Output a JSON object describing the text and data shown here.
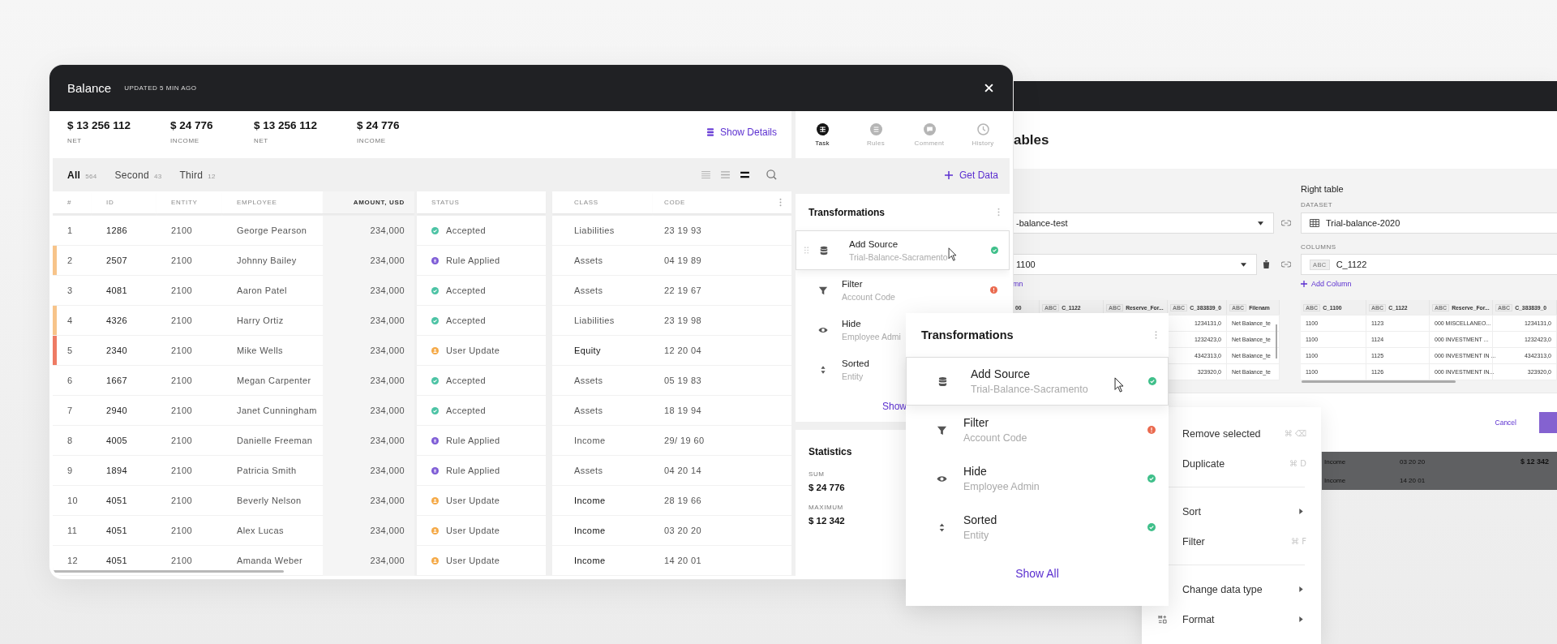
{
  "main_window": {
    "title": "Balance",
    "subtitle": "UPDATED 5 MIN AGO",
    "stats": [
      {
        "value": "$ 13 256 112",
        "label": "NET"
      },
      {
        "value": "$ 24 776",
        "label": "INCOME"
      },
      {
        "value": "$ 13 256 112",
        "label": "NET"
      },
      {
        "value": "$ 24 776",
        "label": "INCOME"
      }
    ],
    "show_details": "Show Details",
    "tabs": [
      {
        "label": "All",
        "count": "564",
        "selected": true
      },
      {
        "label": "Second",
        "count": "43",
        "selected": false
      },
      {
        "label": "Third",
        "count": "12",
        "selected": false
      }
    ],
    "view_options": [
      {
        "kind": "compact",
        "selected": false
      },
      {
        "kind": "normal",
        "selected": false
      },
      {
        "kind": "comfortable",
        "selected": true
      }
    ],
    "table": {
      "columns": [
        "#",
        "ID",
        "ENTITY",
        "EMPLOYEE",
        "AMOUNT, USD",
        "STATUS",
        "CLASS",
        "CODE"
      ],
      "rows": [
        {
          "n": "1",
          "id": "1286",
          "entity": "2100",
          "employee": "George Pearson",
          "amount": "234,000",
          "status": {
            "kind": "accepted",
            "label": "Accepted"
          },
          "class": "Liabilities",
          "class_emphasis": false,
          "code": "23 19 93"
        },
        {
          "n": "2",
          "id": "2507",
          "entity": "2100",
          "employee": "Johnny Bailey",
          "amount": "234,000",
          "status": {
            "kind": "rule",
            "label": "Rule Applied"
          },
          "class": "Assets",
          "class_emphasis": false,
          "code": "04 19 89",
          "color": "#f7c48a"
        },
        {
          "n": "3",
          "id": "4081",
          "entity": "2100",
          "employee": "Aaron Patel",
          "amount": "234,000",
          "status": {
            "kind": "accepted",
            "label": "Accepted"
          },
          "class": "Assets",
          "class_emphasis": false,
          "code": "22 19 67"
        },
        {
          "n": "4",
          "id": "4326",
          "entity": "2100",
          "employee": "Harry Ortiz",
          "amount": "234,000",
          "status": {
            "kind": "accepted",
            "label": "Accepted"
          },
          "class": "Liabilities",
          "class_emphasis": false,
          "code": "23 19 98",
          "color": "#f7c48a"
        },
        {
          "n": "5",
          "id": "2340",
          "entity": "2100",
          "employee": "Mike Wells",
          "amount": "234,000",
          "status": {
            "kind": "user",
            "label": "User Update"
          },
          "class": "Equity",
          "class_emphasis": true,
          "code": "12 20 04",
          "color": "#ee7b64"
        },
        {
          "n": "6",
          "id": "1667",
          "entity": "2100",
          "employee": "Megan Carpenter",
          "amount": "234,000",
          "status": {
            "kind": "accepted",
            "label": "Accepted"
          },
          "class": "Assets",
          "class_emphasis": false,
          "code": "05 19 83"
        },
        {
          "n": "7",
          "id": "2940",
          "entity": "2100",
          "employee": "Janet Cunningham",
          "amount": "234,000",
          "status": {
            "kind": "accepted",
            "label": "Accepted"
          },
          "class": "Assets",
          "class_emphasis": false,
          "code": "18 19 94"
        },
        {
          "n": "8",
          "id": "4005",
          "entity": "2100",
          "employee": "Danielle Freeman",
          "amount": "234,000",
          "status": {
            "kind": "rule",
            "label": "Rule Applied"
          },
          "class": "Income",
          "class_emphasis": false,
          "code": "29/ 19 60"
        },
        {
          "n": "9",
          "id": "1894",
          "entity": "2100",
          "employee": "Patricia Smith",
          "amount": "234,000",
          "status": {
            "kind": "rule",
            "label": "Rule Applied"
          },
          "class": "Assets",
          "class_emphasis": false,
          "code": "04 20 14"
        },
        {
          "n": "10",
          "id": "4051",
          "entity": "2100",
          "employee": "Beverly Nelson",
          "amount": "234,000",
          "status": {
            "kind": "user",
            "label": "User Update"
          },
          "class": "Income",
          "class_emphasis": true,
          "code": "28 19 66"
        },
        {
          "n": "11",
          "id": "4051",
          "entity": "2100",
          "employee": "Alex Lucas",
          "amount": "234,000",
          "status": {
            "kind": "user",
            "label": "User Update"
          },
          "class": "Income",
          "class_emphasis": true,
          "code": "03 20 20"
        },
        {
          "n": "12",
          "id": "4051",
          "entity": "2100",
          "employee": "Amanda Weber",
          "amount": "234,000",
          "status": {
            "kind": "user",
            "label": "User Update"
          },
          "class": "Income",
          "class_emphasis": true,
          "code": "14 20 01"
        }
      ]
    },
    "side_tabs": [
      {
        "kind": "task",
        "label": "Task",
        "selected": true
      },
      {
        "kind": "rules",
        "label": "Rules",
        "selected": false
      },
      {
        "kind": "comment",
        "label": "Comment",
        "selected": false
      },
      {
        "kind": "history",
        "label": "History",
        "selected": false
      }
    ],
    "get_data": "Get Data",
    "transformations": {
      "title": "Transformations",
      "items": [
        {
          "kind": "source",
          "title": "Add Source",
          "subtitle": "Trial-Balance-Sacramento",
          "status": {
            "kind": "ok"
          },
          "selected": true
        },
        {
          "kind": "filter",
          "title": "Filter",
          "subtitle": "Account Code",
          "status": {
            "kind": "error"
          },
          "selected": false
        },
        {
          "kind": "hide",
          "title": "Hide",
          "subtitle": "Employee Admi",
          "selected": false
        },
        {
          "kind": "sort",
          "title": "Sorted",
          "subtitle": "Entity",
          "selected": false
        }
      ],
      "show_all": "Show"
    },
    "statistics": {
      "title": "Statistics",
      "items": [
        {
          "label": "SUM",
          "value": "$ 24 776"
        },
        {
          "label": "MAXIMUM",
          "value": "$ 12 342"
        }
      ]
    }
  },
  "transformations_popup": {
    "title": "Transformations",
    "items": [
      {
        "kind": "source",
        "title": "Add Source",
        "subtitle": "Trial-Balance-Sacramento",
        "status": {
          "kind": "ok"
        },
        "selected": true
      },
      {
        "kind": "filter",
        "title": "Filter",
        "subtitle": "Account Code",
        "status": {
          "kind": "error"
        },
        "selected": false
      },
      {
        "kind": "hide",
        "title": "Hide",
        "subtitle": "Employee Admin",
        "status": {
          "kind": "ok"
        },
        "selected": false
      },
      {
        "kind": "sort",
        "title": "Sorted",
        "subtitle": "Entity",
        "status": {
          "kind": "ok"
        },
        "selected": false
      }
    ],
    "show_all": "Show All"
  },
  "context_menu": {
    "items": [
      {
        "kind": "item",
        "label": "Remove selected",
        "shortcut": "⌘ ⌫"
      },
      {
        "kind": "item",
        "label": "Duplicate",
        "shortcut": "⌘ D"
      },
      {
        "kind": "divider"
      },
      {
        "kind": "submenu",
        "label": "Sort"
      },
      {
        "kind": "item",
        "label": "Filter",
        "shortcut": "⌘ F"
      },
      {
        "kind": "divider"
      },
      {
        "kind": "submenu",
        "label": "Change data type"
      },
      {
        "kind": "tool",
        "label": "Format"
      }
    ]
  },
  "back_window": {
    "title": "ables",
    "left": {
      "dataset": "-balance-test",
      "column": "1100",
      "add_column": "mn",
      "table": {
        "columns": [
          {
            "name": "00"
          },
          {
            "type": "ABC",
            "name": "C_1122"
          },
          {
            "type": "ABC",
            "name": "Reserve_For..."
          },
          {
            "type": "ABC",
            "name": "C_383839_0"
          },
          {
            "type": "ABC",
            "name": "Filenam"
          }
        ],
        "rows": [
          [
            "1234131,0",
            "Net Balance_te"
          ],
          [
            "1232423,0",
            "Net Balance_te"
          ],
          [
            "4342313,0",
            "Net Balance_te"
          ],
          [
            "323920,0",
            "Net Balance_te"
          ]
        ]
      }
    },
    "right": {
      "title": "Right table",
      "dataset_label": "DATASET",
      "dataset": "Trial-balance-2020",
      "columns_label": "COLUMNS",
      "column": {
        "type": "ABC",
        "name": "C_1122"
      },
      "add_column": "Add Column",
      "table": {
        "columns": [
          {
            "type": "ABC",
            "name": "C_1100"
          },
          {
            "type": "ABC",
            "name": "C_1122"
          },
          {
            "type": "ABC",
            "name": "Reserve_For..."
          },
          {
            "type": "ABC",
            "name": "C_383839_0"
          }
        ],
        "rows": [
          [
            "1100",
            "1123",
            "000 MISCELLANEO...",
            "1234131,0"
          ],
          [
            "1100",
            "1124",
            "000 INVESTMENT ...",
            "1232423,0"
          ],
          [
            "1100",
            "1125",
            "000 INVESTMENT IN ...",
            "4342313,0"
          ],
          [
            "1100",
            "1126",
            "000 INVESTMENT IN...",
            "323920,0"
          ]
        ]
      }
    },
    "cancel": "Cancel",
    "shadow_rows": [
      {
        "class": "Income",
        "code": "03 20 20",
        "amount": "$ 12 342"
      },
      {
        "class": "Income",
        "code": "14 20 01"
      }
    ]
  }
}
